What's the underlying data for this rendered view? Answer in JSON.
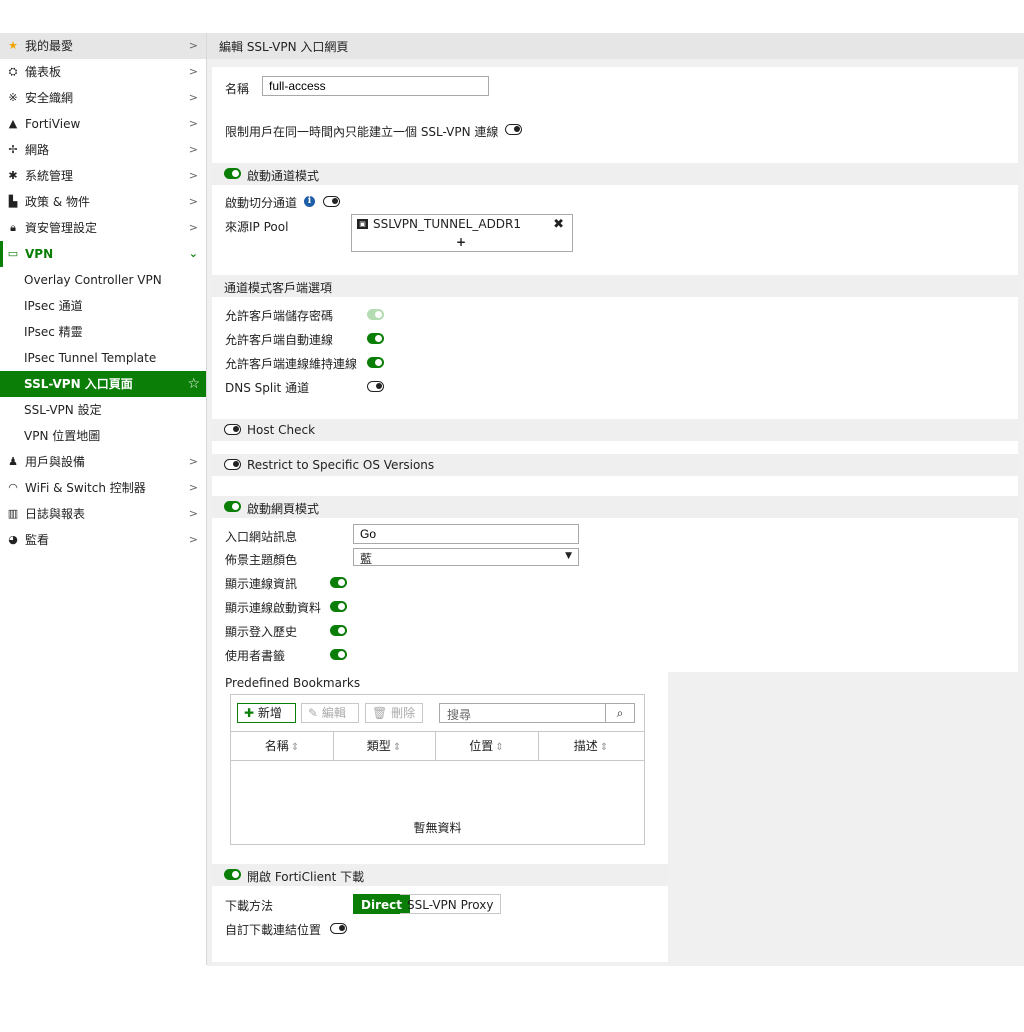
{
  "sidebar": {
    "items": [
      {
        "label": "我的最愛",
        "icon": "star-icon"
      },
      {
        "label": "儀表板",
        "icon": "dashboard-icon"
      },
      {
        "label": "安全織網",
        "icon": "fabric-icon"
      },
      {
        "label": "FortiView",
        "icon": "chart-icon"
      },
      {
        "label": "網路",
        "icon": "network-icon"
      },
      {
        "label": "系統管理",
        "icon": "gear-icon"
      },
      {
        "label": "政策 & 物件",
        "icon": "policy-icon"
      },
      {
        "label": "資安管理設定",
        "icon": "lock-icon"
      },
      {
        "label": "VPN",
        "icon": "monitor-icon"
      }
    ],
    "vpn_sub": [
      "Overlay Controller VPN",
      "IPsec 通道",
      "IPsec 精靈",
      "IPsec Tunnel Template",
      "SSL-VPN 入口頁面",
      "SSL-VPN 設定",
      "VPN 位置地圖"
    ],
    "items_after": [
      {
        "label": "用戶與設備",
        "icon": "user-icon"
      },
      {
        "label": "WiFi & Switch 控制器",
        "icon": "wifi-icon"
      },
      {
        "label": "日誌與報表",
        "icon": "report-icon"
      },
      {
        "label": "監看",
        "icon": "monitor-chart-icon"
      }
    ]
  },
  "header": {
    "title": "編輯 SSL-VPN 入口網頁"
  },
  "form": {
    "name_label": "名稱",
    "name_value": "full-access",
    "limit_label": "限制用戶在同一時間內只能建立一個 SSL-VPN 連線",
    "tunnel_mode_label": "啟動通道模式",
    "split_tunnel_label": "啟動切分通道",
    "ip_pool_label": "來源IP Pool",
    "ip_pool_value": "SSLVPN_TUNNEL_ADDR1",
    "client_options_label": "通道模式客戶端選項",
    "save_password_label": "允許客戶端儲存密碼",
    "auto_connect_label": "允許客戶端自動連線",
    "keep_alive_label": "允許客戶端連線維持連線",
    "dns_split_label": "DNS Split 通道",
    "host_check_label": "Host Check",
    "restrict_os_label": "Restrict to Specific OS Versions",
    "web_mode_label": "啟動網頁模式",
    "portal_message_label": "入口網站訊息",
    "portal_message_value": "Go",
    "theme_label": "佈景主題顏色",
    "theme_value": "藍",
    "show_session_label": "顯示連線資訊",
    "show_conn_launcher_label": "顯示連線啟動資料",
    "show_login_history_label": "顯示登入歷史",
    "user_bookmarks_label": "使用者書籤",
    "predefined_bookmarks_label": "Predefined Bookmarks",
    "forticlient_label": "開啟 FortiClient 下載",
    "download_method_label": "下載方法",
    "download_direct": "Direct",
    "download_proxy": "SSL-VPN Proxy",
    "custom_download_label": "自訂下載連結位置"
  },
  "bookmarks": {
    "add_label": "新增",
    "edit_label": "編輯",
    "delete_label": "刪除",
    "search_placeholder": "搜尋",
    "columns": [
      "名稱",
      "類型",
      "位置",
      "描述"
    ],
    "empty_text": "暫無資料"
  },
  "colors": {
    "accent": "#0a7e07",
    "section_bg": "#efefef"
  }
}
